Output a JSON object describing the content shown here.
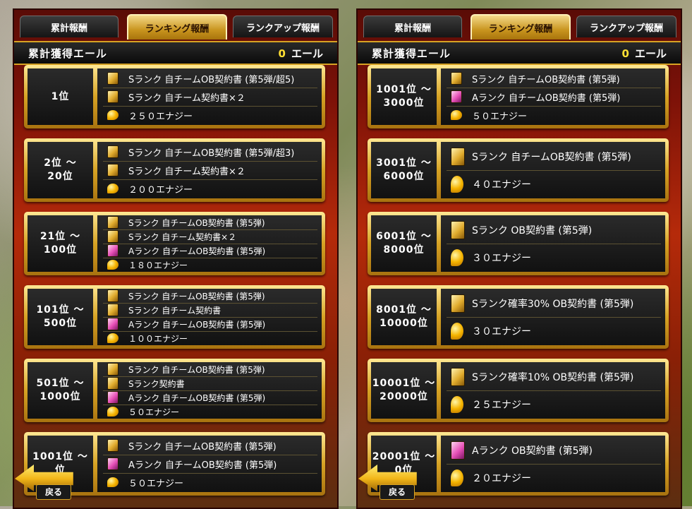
{
  "tabs": {
    "cumulative": "累計報酬",
    "ranking": "ランキング報酬",
    "rankup": "ランクアップ報酬"
  },
  "header": {
    "label": "累計獲得エール",
    "value": "0",
    "unit": "エール"
  },
  "back_label": "戻る",
  "left_cards": [
    {
      "rank": [
        "1位"
      ],
      "rewards": [
        {
          "icon": "s-contract-icon",
          "text": "Sランク 自チームOB契約書 (第5弾/超5)"
        },
        {
          "icon": "s-contract-icon",
          "text": "Sランク 自チーム契約書×２"
        },
        {
          "icon": "energy-icon",
          "text": "２５０エナジー"
        }
      ]
    },
    {
      "rank": [
        "2位 ～",
        "20位"
      ],
      "rewards": [
        {
          "icon": "s-contract-icon",
          "text": "Sランク 自チームOB契約書 (第5弾/超3)"
        },
        {
          "icon": "s-contract-icon",
          "text": "Sランク 自チーム契約書×２"
        },
        {
          "icon": "energy-icon",
          "text": "２００エナジー"
        }
      ]
    },
    {
      "rank": [
        "21位 ～",
        "100位"
      ],
      "rewards": [
        {
          "icon": "s-contract-icon",
          "text": "Sランク 自チームOB契約書 (第5弾)"
        },
        {
          "icon": "s-contract-icon",
          "text": "Sランク 自チーム契約書×２"
        },
        {
          "icon": "a-contract-icon",
          "text": "Aランク 自チームOB契約書 (第5弾)"
        },
        {
          "icon": "energy-icon",
          "text": "１８０エナジー"
        }
      ]
    },
    {
      "rank": [
        "101位 ～",
        "500位"
      ],
      "rewards": [
        {
          "icon": "s-contract-icon",
          "text": "Sランク 自チームOB契約書 (第5弾)"
        },
        {
          "icon": "s-contract-icon",
          "text": "Sランク 自チーム契約書"
        },
        {
          "icon": "a-contract-icon",
          "text": "Aランク 自チームOB契約書 (第5弾)"
        },
        {
          "icon": "energy-icon",
          "text": "１００エナジー"
        }
      ]
    },
    {
      "rank": [
        "501位 ～",
        "1000位"
      ],
      "rewards": [
        {
          "icon": "s-contract-icon",
          "text": "Sランク 自チームOB契約書 (第5弾)"
        },
        {
          "icon": "s-contract-icon",
          "text": "Sランク契約書"
        },
        {
          "icon": "a-contract-icon",
          "text": "Aランク 自チームOB契約書 (第5弾)"
        },
        {
          "icon": "energy-icon",
          "text": "５０エナジー"
        }
      ]
    },
    {
      "rank": [
        "1001位 ～",
        "位"
      ],
      "rewards": [
        {
          "icon": "s-contract-icon",
          "text": "Sランク 自チームOB契約書 (第5弾)"
        },
        {
          "icon": "a-contract-icon",
          "text": "Aランク 自チームOB契約書 (第5弾)"
        },
        {
          "icon": "energy-icon",
          "text": "５０エナジー"
        }
      ]
    }
  ],
  "right_cards": [
    {
      "rank": [
        "1001位 ～",
        "3000位"
      ],
      "rewards": [
        {
          "icon": "s-contract-icon",
          "text": "Sランク 自チームOB契約書 (第5弾)"
        },
        {
          "icon": "a-contract-icon",
          "text": "Aランク 自チームOB契約書 (第5弾)"
        },
        {
          "icon": "energy-icon",
          "text": "５０エナジー"
        }
      ]
    },
    {
      "rank": [
        "3001位 ～",
        "6000位"
      ],
      "rewards": [
        {
          "icon": "s-contract-icon",
          "text": "Sランク 自チームOB契約書 (第5弾)"
        },
        {
          "icon": "energy-icon",
          "text": "４０エナジー"
        }
      ]
    },
    {
      "rank": [
        "6001位 ～",
        "8000位"
      ],
      "rewards": [
        {
          "icon": "s-contract-icon",
          "text": "Sランク OB契約書 (第5弾)"
        },
        {
          "icon": "energy-icon",
          "text": "３０エナジー"
        }
      ]
    },
    {
      "rank": [
        "8001位 ～",
        "10000位"
      ],
      "rewards": [
        {
          "icon": "s-contract-icon",
          "text": "Sランク確率30% OB契約書 (第5弾)"
        },
        {
          "icon": "energy-icon",
          "text": "３０エナジー"
        }
      ]
    },
    {
      "rank": [
        "10001位 ～",
        "20000位"
      ],
      "rewards": [
        {
          "icon": "s-contract-icon",
          "text": "Sランク確率10% OB契約書 (第5弾)"
        },
        {
          "icon": "energy-icon",
          "text": "２５エナジー"
        }
      ]
    },
    {
      "rank": [
        "20001位 ～",
        "0位"
      ],
      "rewards": [
        {
          "icon": "a-contract-icon",
          "text": "Aランク OB契約書 (第5弾)"
        },
        {
          "icon": "energy-icon",
          "text": "２０エナジー"
        }
      ]
    }
  ]
}
